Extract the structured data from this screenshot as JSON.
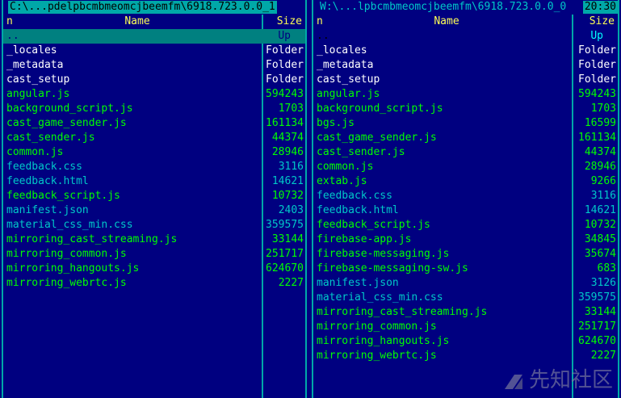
{
  "left_panel": {
    "path": "C:\\...pdelpbcmbmeomcjbeemfm\\6918.723.0.0_1",
    "header": {
      "n": "n",
      "name": "Name",
      "size": "Size"
    },
    "rows": [
      {
        "name": "..",
        "size": "Up",
        "type": "up"
      },
      {
        "name": "_locales",
        "size": "Folder",
        "type": "folder"
      },
      {
        "name": "_metadata",
        "size": "Folder",
        "type": "folder"
      },
      {
        "name": "cast_setup",
        "size": "Folder",
        "type": "folder"
      },
      {
        "name": "angular.js",
        "size": "594243",
        "type": "file"
      },
      {
        "name": "background_script.js",
        "size": "1703",
        "type": "file"
      },
      {
        "name": "cast_game_sender.js",
        "size": "161134",
        "type": "file"
      },
      {
        "name": "cast_sender.js",
        "size": "44374",
        "type": "file"
      },
      {
        "name": "common.js",
        "size": "28946",
        "type": "file"
      },
      {
        "name": "feedback.css",
        "size": "3116",
        "type": "blue"
      },
      {
        "name": "feedback.html",
        "size": "14621",
        "type": "blue"
      },
      {
        "name": "feedback_script.js",
        "size": "10732",
        "type": "file"
      },
      {
        "name": "manifest.json",
        "size": "2403",
        "type": "blue"
      },
      {
        "name": "material_css_min.css",
        "size": "359575",
        "type": "blue"
      },
      {
        "name": "mirroring_cast_streaming.js",
        "size": "33144",
        "type": "file"
      },
      {
        "name": "mirroring_common.js",
        "size": "251717",
        "type": "file"
      },
      {
        "name": "mirroring_hangouts.js",
        "size": "624670",
        "type": "file"
      },
      {
        "name": "mirroring_webrtc.js",
        "size": "2227",
        "type": "file"
      }
    ]
  },
  "right_panel": {
    "path": "W:\\...lpbcmbmeomcjbeemfm\\6918.723.0.0_0",
    "clock": "20:30",
    "header": {
      "n": "n",
      "name": "Name",
      "size": "Size"
    },
    "rows": [
      {
        "name": "..",
        "size": "Up",
        "type": "up"
      },
      {
        "name": "_locales",
        "size": "Folder",
        "type": "folder"
      },
      {
        "name": "_metadata",
        "size": "Folder",
        "type": "folder"
      },
      {
        "name": "cast_setup",
        "size": "Folder",
        "type": "folder"
      },
      {
        "name": "angular.js",
        "size": "594243",
        "type": "file"
      },
      {
        "name": "background_script.js",
        "size": "1703",
        "type": "file"
      },
      {
        "name": "bgs.js",
        "size": "16599",
        "type": "file"
      },
      {
        "name": "cast_game_sender.js",
        "size": "161134",
        "type": "file"
      },
      {
        "name": "cast_sender.js",
        "size": "44374",
        "type": "file"
      },
      {
        "name": "common.js",
        "size": "28946",
        "type": "file"
      },
      {
        "name": "extab.js",
        "size": "9266",
        "type": "file"
      },
      {
        "name": "feedback.css",
        "size": "3116",
        "type": "blue"
      },
      {
        "name": "feedback.html",
        "size": "14621",
        "type": "blue"
      },
      {
        "name": "feedback_script.js",
        "size": "10732",
        "type": "file"
      },
      {
        "name": "firebase-app.js",
        "size": "34845",
        "type": "file"
      },
      {
        "name": "firebase-messaging.js",
        "size": "35674",
        "type": "file"
      },
      {
        "name": "firebase-messaging-sw.js",
        "size": "683",
        "type": "file"
      },
      {
        "name": "manifest.json",
        "size": "3126",
        "type": "blue"
      },
      {
        "name": "material_css_min.css",
        "size": "359575",
        "type": "blue"
      },
      {
        "name": "mirroring_cast_streaming.js",
        "size": "33144",
        "type": "file"
      },
      {
        "name": "mirroring_common.js",
        "size": "251717",
        "type": "file"
      },
      {
        "name": "mirroring_hangouts.js",
        "size": "624670",
        "type": "file"
      },
      {
        "name": "mirroring_webrtc.js",
        "size": "2227",
        "type": "file"
      }
    ]
  },
  "watermark": {
    "text": "先知社区",
    "icon": "xianzhi-logo-icon"
  }
}
